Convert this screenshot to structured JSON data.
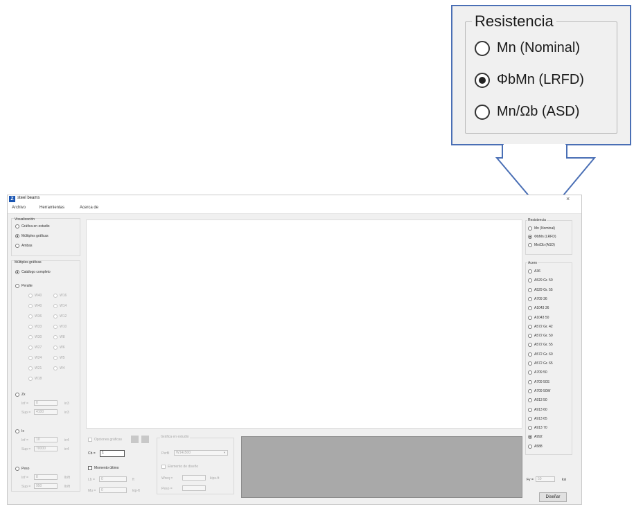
{
  "callout": {
    "legend": "Resistencia",
    "options": [
      {
        "label": "Mn (Nominal)",
        "checked": false
      },
      {
        "label": "ΦbMn (LRFD)",
        "checked": true
      },
      {
        "label": "Mn/Ωb (ASD)",
        "checked": false
      }
    ]
  },
  "window": {
    "title": "steel beams",
    "close_glyph": "×",
    "menu": [
      "Archivo",
      "Herramientas",
      "Acerca de"
    ]
  },
  "left": {
    "visualizacion": {
      "legend": "Visualización",
      "options": [
        {
          "label": "Gráfica en estudio",
          "checked": false
        },
        {
          "label": "Múltiples gráficas",
          "checked": true
        },
        {
          "label": "Ambas",
          "checked": false
        }
      ]
    },
    "multiples": {
      "legend": "Múltiples gráficas",
      "catalogo": "Catálogo completo",
      "peralte": "Peralte",
      "peralte_col1": [
        "W40",
        "W40",
        "W36",
        "W33",
        "W30",
        "W27",
        "W24",
        "W21",
        "W18"
      ],
      "peralte_col2": [
        "W16",
        "W14",
        "W12",
        "W10",
        "W8",
        "W6",
        "W5",
        "W4"
      ],
      "zx": "Zx",
      "zx_min_label": "Inf =",
      "zx_min_value": "0",
      "zx_max_label": "Sup =",
      "zx_max_value": "4100",
      "zx_unit": "in3",
      "ix": "Ix",
      "ix_min_label": "Inf =",
      "ix_min_value": "10",
      "ix_max_label": "Sup =",
      "ix_max_value": "70000",
      "ix_unit": "in4",
      "peso": "Peso",
      "peso_min_label": "Inf =",
      "peso_min_value": "8",
      "peso_max_label": "Sup =",
      "peso_max_value": "950",
      "peso_unit": "lb/ft"
    }
  },
  "bottom": {
    "opciones_graficas": "Opciones gráficas",
    "cb_label": "Cb =",
    "cb_value": "1",
    "momento_ultimo": "Momento último",
    "lb_label": "Lb =",
    "lb_value": "0",
    "lb_unit": "ft",
    "mu_label": "Mu =",
    "mu_value": "0",
    "mu_unit": "kip-ft",
    "grafica_estudio": {
      "legend": "Gráfica en estudio",
      "perfil_label": "Perfil",
      "perfil_value": "W14x500",
      "elemento_diseno": "Elemento de diseño",
      "wreq_label": "Wreq =",
      "wreq_unit": "kips-ft",
      "peso_label": "Peso ="
    }
  },
  "right": {
    "resistencia": {
      "legend": "Resistencia",
      "options": [
        {
          "label": "Mn (Nominal)",
          "checked": false
        },
        {
          "label": "ΦbMn (LRFD)",
          "checked": true
        },
        {
          "label": "Mn/Ωb (ASD)",
          "checked": false
        }
      ]
    },
    "acero": {
      "legend": "Acero",
      "options": [
        {
          "label": "A36",
          "checked": false
        },
        {
          "label": "A529 Gr. 50",
          "checked": false
        },
        {
          "label": "A529 Gr. 55",
          "checked": false
        },
        {
          "label": "A709 36",
          "checked": false
        },
        {
          "label": "A1043 36",
          "checked": false
        },
        {
          "label": "A1043 50",
          "checked": false
        },
        {
          "label": "A572 Gr. 42",
          "checked": false
        },
        {
          "label": "A572 Gr. 50",
          "checked": false
        },
        {
          "label": "A572 Gr. 55",
          "checked": false
        },
        {
          "label": "A572 Gr. 60",
          "checked": false
        },
        {
          "label": "A572 Gr. 65",
          "checked": false
        },
        {
          "label": "A709 50",
          "checked": false
        },
        {
          "label": "A709 50S",
          "checked": false
        },
        {
          "label": "A709 50W",
          "checked": false
        },
        {
          "label": "A913 50",
          "checked": false
        },
        {
          "label": "A913 60",
          "checked": false
        },
        {
          "label": "A913 65",
          "checked": false
        },
        {
          "label": "A913 70",
          "checked": false
        },
        {
          "label": "A992",
          "checked": true
        },
        {
          "label": "A588",
          "checked": false
        }
      ]
    },
    "fy_label": "Fy =",
    "fy_value": "50",
    "fy_unit": "ksi",
    "disenar": "Diseñar"
  }
}
